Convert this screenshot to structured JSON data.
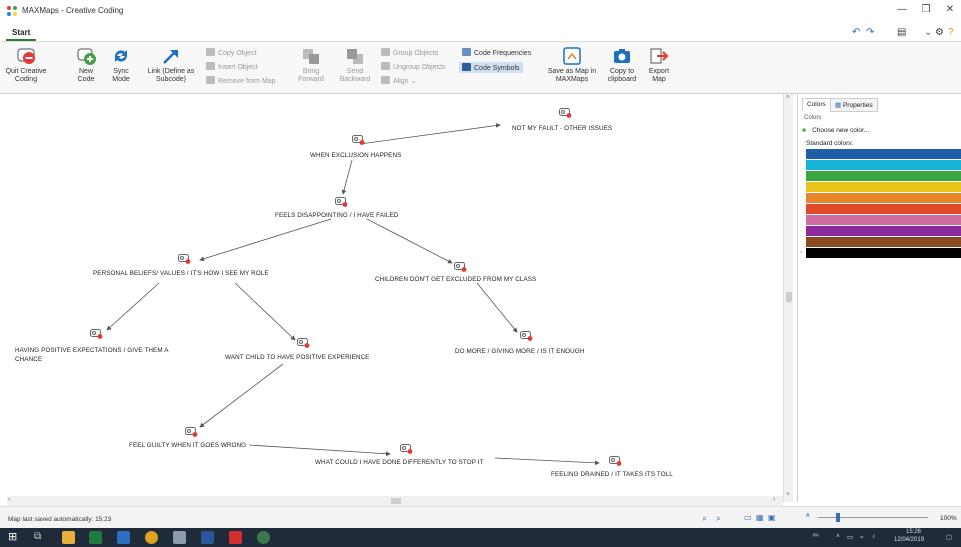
{
  "window": {
    "title": "MAXMaps - Creative Coding",
    "controls": [
      "—",
      "❐",
      "✕"
    ]
  },
  "tabs": {
    "start": "Start"
  },
  "ribbon": {
    "quit": "Quit Creative\nCoding",
    "new_code": "New\nCode",
    "sync_mode": "Sync\nMode",
    "link": "Link (Define as\nSubcode)",
    "copy_object": "Copy Object",
    "insert_object": "Insert Object",
    "remove_from_map": "Remove from Map",
    "bring_forward": "Bring\nForward",
    "send_backward": "Send\nBackward",
    "group_objects": "Group Objects",
    "ungroup_objects": "Ungroup Objects",
    "align": "Align",
    "code_frequencies": "Code Frequencies",
    "code_symbols": "Code Symbols",
    "save_as_map": "Save as Map in\nMAXMaps",
    "copy_clipboard": "Copy to\nclipboard",
    "export_map": "Export\nMap"
  },
  "nodes": [
    {
      "id": "n1",
      "label": "NOT MY FAULT - OTHER ISSUES"
    },
    {
      "id": "n2",
      "label": "WHEN EXCLUSION HAPPENS"
    },
    {
      "id": "n3",
      "label": "FEELS DISAPPOINTING / I HAVE FAILED"
    },
    {
      "id": "n4",
      "label": "PERSONAL BELIEFS/ VALUES / IT'S HOW I SEE MY ROLE"
    },
    {
      "id": "n5",
      "label": "CHILDREN DON'T GET EXCLUDED FROM MY CLASS"
    },
    {
      "id": "n6",
      "label": "HAVING POSITIVE EXPECTATIONS / GIVE THEM A"
    },
    {
      "id": "n6b",
      "label": "CHANCE"
    },
    {
      "id": "n7",
      "label": "WANT CHILD TO HAVE POSITIVE EXPERIENCE"
    },
    {
      "id": "n8",
      "label": "DO MORE / GIVING MORE / IS IT ENOUGH"
    },
    {
      "id": "n9",
      "label": "FEEL GUILTY WHEN IT GOES WRONG"
    },
    {
      "id": "n10",
      "label": "WHAT COULD I HAVE DONE DIFFERENTLY TO STOP IT"
    },
    {
      "id": "n11",
      "label": "FEELING DRAINED / IT TAKES ITS TOLL"
    }
  ],
  "panel": {
    "tab_colors": "Colors",
    "tab_properties": "Properties",
    "section": "Colors",
    "choose_new_color": "Choose new color...",
    "standard_colors": "Standard colors:",
    "swatches": [
      "#1f5fa8",
      "#17b3d4",
      "#3aa640",
      "#e8c31a",
      "#e8842a",
      "#e04a2a",
      "#d06aa0",
      "#8e2a9a",
      "#8a4a1e",
      "#000000"
    ]
  },
  "status": {
    "saved": "Map last saved automatically: 15:23",
    "zoom": "100%"
  },
  "taskbar": {
    "time": "15:26",
    "date": "12/04/2019"
  }
}
